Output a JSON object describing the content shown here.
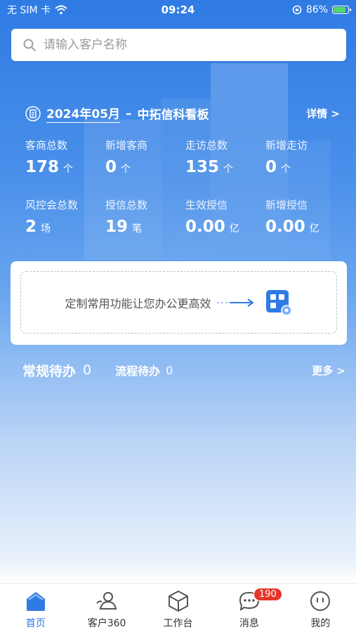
{
  "status_bar": {
    "carrier": "无 SIM 卡",
    "time": "09:24",
    "battery": "86%"
  },
  "search": {
    "placeholder": "请输入客户名称"
  },
  "board": {
    "month": "2024年05月",
    "separator": "–",
    "name": "中拓信科看板",
    "detail_link": "详情 >"
  },
  "stats": [
    {
      "label": "客商总数",
      "value": "178",
      "unit": "个"
    },
    {
      "label": "新增客商",
      "value": "0",
      "unit": "个"
    },
    {
      "label": "走访总数",
      "value": "135",
      "unit": "个"
    },
    {
      "label": "新增走访",
      "value": "0",
      "unit": "个"
    },
    {
      "label": "风控会总数",
      "value": "2",
      "unit": "场"
    },
    {
      "label": "授信总数",
      "value": "19",
      "unit": "笔"
    },
    {
      "label": "生效授信",
      "value": "0.00",
      "unit": "亿"
    },
    {
      "label": "新增授信",
      "value": "0.00",
      "unit": "亿"
    }
  ],
  "customize": {
    "text": "定制常用功能让您办公更高效"
  },
  "todo": {
    "regular_label": "常规待办",
    "regular_count": "0",
    "flow_label": "流程待办",
    "flow_count": "0",
    "more_link": "更多 >"
  },
  "tabs": [
    {
      "label": "首页",
      "icon": "home-icon",
      "active": true
    },
    {
      "label": "客户360",
      "icon": "customer-icon",
      "active": false
    },
    {
      "label": "工作台",
      "icon": "box-icon",
      "active": false
    },
    {
      "label": "消息",
      "icon": "message-icon",
      "active": false,
      "badge": "190"
    },
    {
      "label": "我的",
      "icon": "profile-icon",
      "active": false
    }
  ],
  "colors": {
    "primary": "#2f7be3",
    "badge": "#e8352a",
    "battery": "#55d66a"
  }
}
